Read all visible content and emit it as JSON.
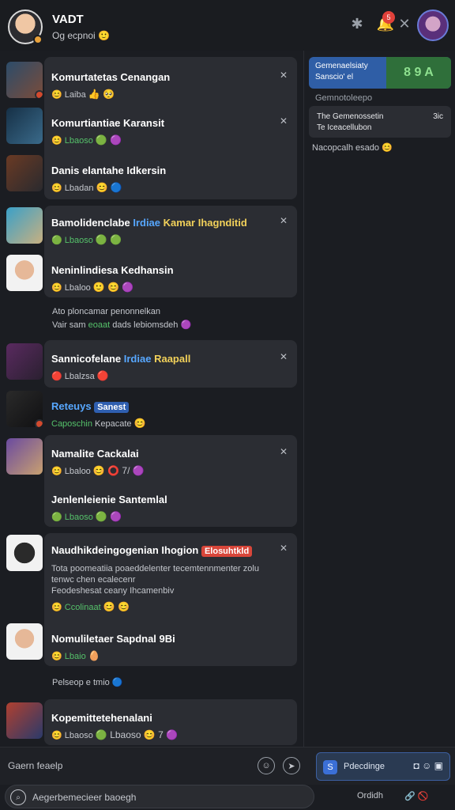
{
  "header": {
    "title": "VADT",
    "subtitle": "Og ecpnoi 🙂",
    "notification_count": "5",
    "icons": [
      "star-icon",
      "bell-icon",
      "close-icon"
    ]
  },
  "feed": {
    "items": [
      {
        "title": "Komurtatetas Cenangan",
        "meta": "Laiba",
        "reactions": "👍 🥺"
      },
      {
        "title": "Komurtiantiae Karansit",
        "meta": "Lbaoso",
        "reactions": "🟢 🟣"
      },
      {
        "title": "Danis elantahe Idkersin",
        "meta": "Lbadan",
        "reactions": "😊 🔵"
      },
      {
        "title_a": "Bamolidenclabe",
        "title_b": "Irdiae",
        "title_c": "Kamar Ihagnditid",
        "meta": "Lbaoso",
        "reactions": "🟢 🟢"
      },
      {
        "title": "Neninlindiesa Kedhansin",
        "meta": "Lbaloo",
        "reactions": "🙂 😊 🟣"
      },
      {
        "title_a": "Sannicofelane",
        "title_b": "Irdiae",
        "title_c": "Raapall",
        "meta": "Lbalzsa",
        "reactions": "🔴"
      },
      {
        "title_a": "Reteuys",
        "title_b": "Sanest",
        "meta": "Caposchin",
        "meta2": "Kepacate",
        "reactions": "😊"
      },
      {
        "title": "Namalite Cackalai",
        "meta": "Lbaloo",
        "reactions": "😊 ⭕ 7/ 🟣"
      },
      {
        "title": "Jenlenleienie Santemlal",
        "meta": "Lbaoso",
        "reactions": "🟢 🟣"
      },
      {
        "title": "Naudhikdeingogenian Ihogion",
        "tag": "Elosuhtkld",
        "body1": "Tota poomeatiia poaeddelenter tecemtennmenter zolu",
        "body2": "tenwc chen ecalecenr",
        "body3": "Feodeshesat ceany Ihcamenbiv",
        "meta": "Ccolinaat",
        "reactions": "😊 😊"
      },
      {
        "title": "Nomuliletaer Sapdnal 9Bi",
        "meta": "Lbaio",
        "reactions": "🥚"
      },
      {
        "title": "Kopemittetehenalani",
        "meta": "Lbaoso",
        "reactions": "🟢 Lbaoso 😊 7 🟣"
      }
    ],
    "loose": {
      "a1": "Ato ploncamar penonnelkan",
      "a2": "Vair sam",
      "a3": "eoaat",
      "a4": "dads lebiomsdeh 🟣",
      "b1": "Pelseop e tmio 🔵"
    }
  },
  "right": {
    "pill_line1": "Gemenaelsiaty",
    "pill_line2": "Sanscio' el",
    "pill_stats": "8 9 A",
    "section_label": "Gemnotoleepo",
    "card_a": "The Gemenossetin",
    "card_b": "3ic",
    "card_c": "Te Iceacellubon",
    "note": "Nacopcalh esado 😊"
  },
  "compose": {
    "placeholder": "Gaern feaelp",
    "attach_label": "Pdecdinge"
  },
  "search": {
    "placeholder": "Aegerbemecieer baoegh"
  },
  "footer": {
    "right1": "Ordidh",
    "right2": "🔗 🚫"
  }
}
